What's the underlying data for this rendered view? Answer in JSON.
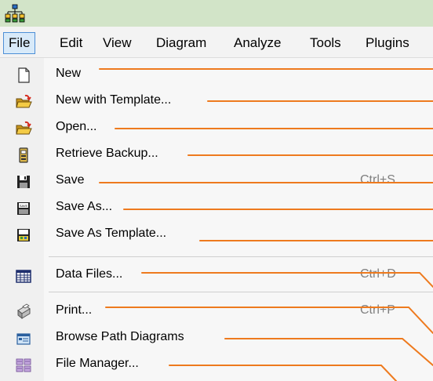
{
  "menubar": {
    "items": [
      {
        "label": "File"
      },
      {
        "label": "Edit"
      },
      {
        "label": "View"
      },
      {
        "label": "Diagram"
      },
      {
        "label": "Analyze"
      },
      {
        "label": "Tools"
      },
      {
        "label": "Plugins"
      }
    ]
  },
  "file_menu": {
    "items": [
      {
        "label": "New",
        "icon": "blank-page-icon"
      },
      {
        "label": "New with Template...",
        "icon": "open-folder-template-icon"
      },
      {
        "label": "Open...",
        "icon": "open-folder-icon"
      },
      {
        "label": "Retrieve Backup...",
        "icon": "backup-icon"
      },
      {
        "label": "Save",
        "shortcut": "Ctrl+S",
        "icon": "floppy-disk-icon"
      },
      {
        "label": "Save As...",
        "icon": "save-as-icon"
      },
      {
        "label": "Save As  Template...",
        "icon": "save-as-template-icon"
      },
      {
        "label": "Data Files...",
        "shortcut": "Ctrl+D",
        "icon": "data-grid-icon"
      },
      {
        "label": "Print...",
        "shortcut": "Ctrl+P",
        "icon": "printer-icon"
      },
      {
        "label": "Browse Path Diagrams",
        "icon": "browse-diagrams-icon"
      },
      {
        "label": "File Manager...",
        "icon": "file-manager-icon"
      }
    ]
  },
  "colors": {
    "leader_line": "#ee7a1e",
    "title_bar": "#d2e4c8",
    "active_menu_border": "#4d8fd6"
  }
}
